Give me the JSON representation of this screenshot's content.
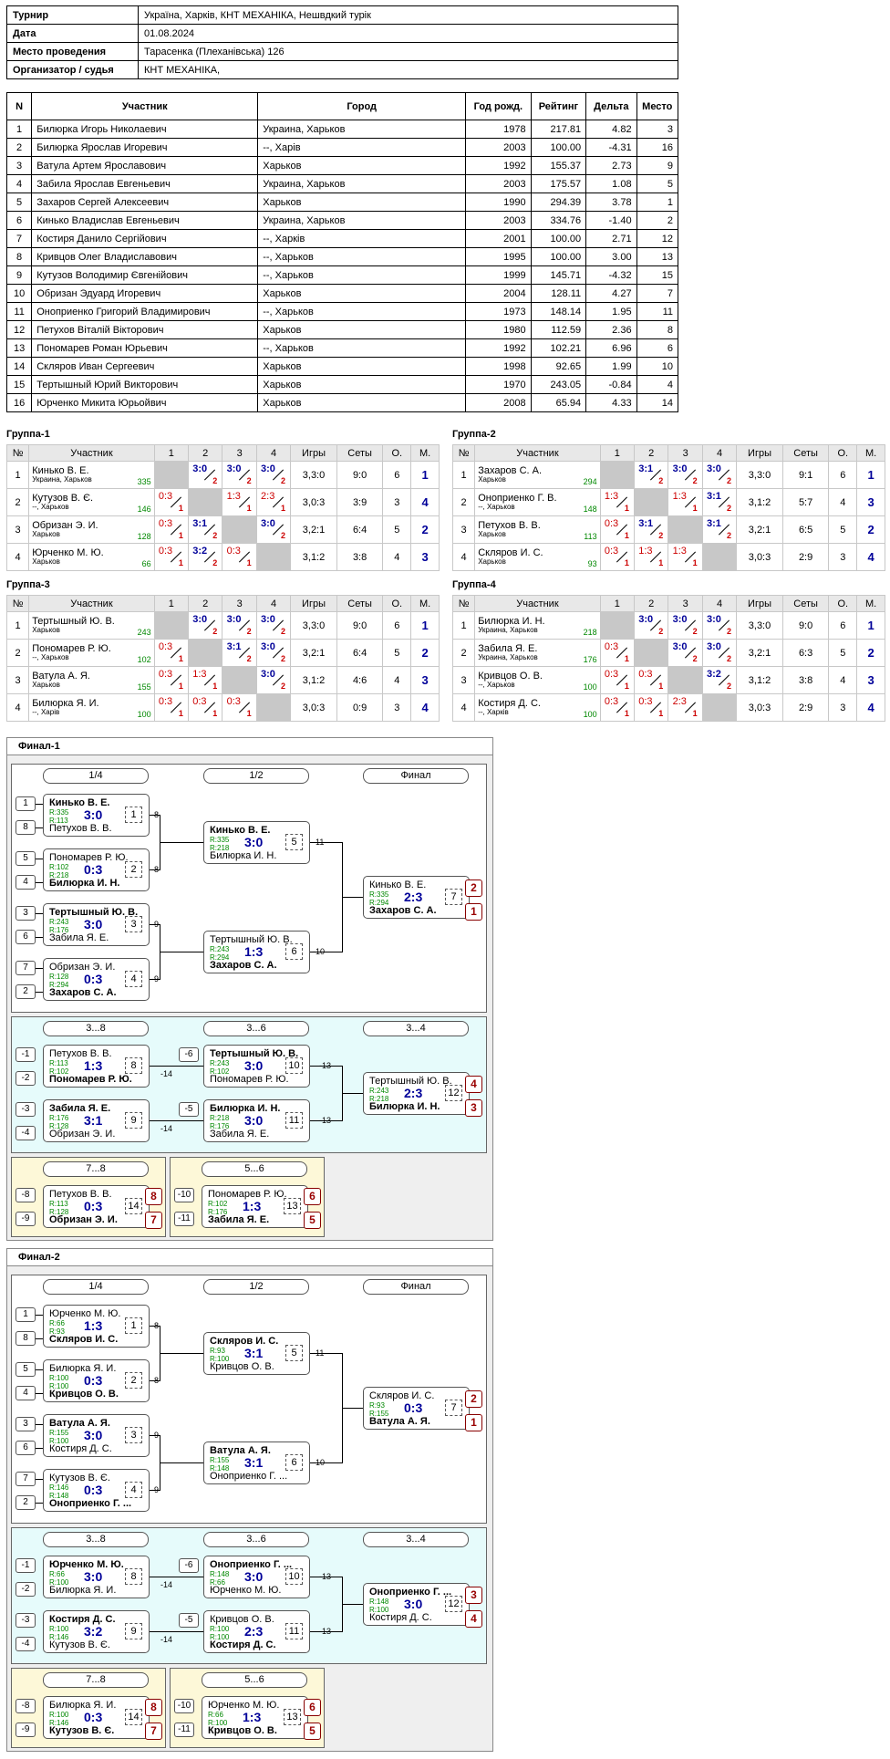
{
  "info": [
    {
      "k": "Турнир",
      "v": "Україна, Харків, КНТ МЕХАНІКА, Нешвдкий турік"
    },
    {
      "k": "Дата",
      "v": "01.08.2024"
    },
    {
      "k": "Место проведения",
      "v": "Тарасенка (Плеханівська) 126"
    },
    {
      "k": "Организатор / судья",
      "v": "КНТ МЕХАНІКА,"
    }
  ],
  "players_header": [
    "N",
    "Участник",
    "Город",
    "Год рожд.",
    "Рейтинг",
    "Дельта",
    "Место"
  ],
  "players": [
    [
      "1",
      "Билюрка Игорь Николаевич",
      "Украина, Харьков",
      "1978",
      "217.81",
      "4.82",
      "3"
    ],
    [
      "2",
      "Билюрка Ярослав Игоревич",
      "--, Харів",
      "2003",
      "100.00",
      "-4.31",
      "16"
    ],
    [
      "3",
      "Ватула Артем Ярославович",
      "Харьков",
      "1992",
      "155.37",
      "2.73",
      "9"
    ],
    [
      "4",
      "Забила Ярослав Евгеньевич",
      "Украина, Харьков",
      "2003",
      "175.57",
      "1.08",
      "5"
    ],
    [
      "5",
      "Захаров Сергей Алексеевич",
      "Харьков",
      "1990",
      "294.39",
      "3.78",
      "1"
    ],
    [
      "6",
      "Кинько Владислав Евгеньевич",
      "Украина, Харьков",
      "2003",
      "334.76",
      "-1.40",
      "2"
    ],
    [
      "7",
      "Костиря Данило Сергійович",
      "--, Харків",
      "2001",
      "100.00",
      "2.71",
      "12"
    ],
    [
      "8",
      "Кривцов Олег Владиславович",
      "--, Харьков",
      "1995",
      "100.00",
      "3.00",
      "13"
    ],
    [
      "9",
      "Кутузов Володимир Євгенійович",
      "--, Харьков",
      "1999",
      "145.71",
      "-4.32",
      "15"
    ],
    [
      "10",
      "Обризан Эдуард Игоревич",
      "Харьков",
      "2004",
      "128.11",
      "4.27",
      "7"
    ],
    [
      "11",
      "Оноприенко Григорий Владимирович",
      "--, Харьков",
      "1973",
      "148.14",
      "1.95",
      "11"
    ],
    [
      "12",
      "Петухов Віталій Вікторович",
      "Харьков",
      "1980",
      "112.59",
      "2.36",
      "8"
    ],
    [
      "13",
      "Пономарев Роман Юрьевич",
      "--, Харьков",
      "1992",
      "102.21",
      "6.96",
      "6"
    ],
    [
      "14",
      "Скляров Иван Сергеевич",
      "Харьков",
      "1998",
      "92.65",
      "1.99",
      "10"
    ],
    [
      "15",
      "Тертышный Юрий Викторович",
      "Харьков",
      "1970",
      "243.05",
      "-0.84",
      "4"
    ],
    [
      "16",
      "Юрченко Микита Юрьойвич",
      "Харьков",
      "2008",
      "65.94",
      "4.33",
      "14"
    ]
  ],
  "group_header": [
    "№",
    "Участник",
    "1",
    "2",
    "3",
    "4",
    "Игры",
    "Сеты",
    "О.",
    "М."
  ],
  "groups": [
    {
      "title": "Группа-1",
      "rows": [
        {
          "n": "1",
          "name": "Кинько В. Е.",
          "city": "Украина, Харьков",
          "r": "335",
          "res": [
            "",
            "3:0|2|w",
            "3:0|2|w",
            "3:0|2|w"
          ],
          "g": "3,3:0",
          "s": "9:0",
          "o": "6",
          "m": "1"
        },
        {
          "n": "2",
          "name": "Кутузов В. Є.",
          "city": "--, Харьков",
          "r": "146",
          "res": [
            "0:3|1|l",
            "",
            "1:3|1|l",
            "2:3|1|l"
          ],
          "g": "3,0:3",
          "s": "3:9",
          "o": "3",
          "m": "4"
        },
        {
          "n": "3",
          "name": "Обризан Э. И.",
          "city": "Харьков",
          "r": "128",
          "res": [
            "0:3|1|l",
            "3:1|2|w",
            "",
            "3:0|2|w"
          ],
          "g": "3,2:1",
          "s": "6:4",
          "o": "5",
          "m": "2"
        },
        {
          "n": "4",
          "name": "Юрченко М. Ю.",
          "city": "Харьков",
          "r": "66",
          "res": [
            "0:3|1|l",
            "3:2|2|w",
            "0:3|1|l",
            ""
          ],
          "g": "3,1:2",
          "s": "3:8",
          "o": "4",
          "m": "3"
        }
      ]
    },
    {
      "title": "Группа-2",
      "rows": [
        {
          "n": "1",
          "name": "Захаров С. А.",
          "city": "Харьков",
          "r": "294",
          "res": [
            "",
            "3:1|2|w",
            "3:0|2|w",
            "3:0|2|w"
          ],
          "g": "3,3:0",
          "s": "9:1",
          "o": "6",
          "m": "1"
        },
        {
          "n": "2",
          "name": "Оноприенко Г. В.",
          "city": "--, Харьков",
          "r": "148",
          "res": [
            "1:3|1|l",
            "",
            "1:3|1|l",
            "3:1|2|w"
          ],
          "g": "3,1:2",
          "s": "5:7",
          "o": "4",
          "m": "3"
        },
        {
          "n": "3",
          "name": "Петухов В. В.",
          "city": "Харьков",
          "r": "113",
          "res": [
            "0:3|1|l",
            "3:1|2|w",
            "",
            "3:1|2|w"
          ],
          "g": "3,2:1",
          "s": "6:5",
          "o": "5",
          "m": "2"
        },
        {
          "n": "4",
          "name": "Скляров И. С.",
          "city": "Харьков",
          "r": "93",
          "res": [
            "0:3|1|l",
            "1:3|1|l",
            "1:3|1|l",
            ""
          ],
          "g": "3,0:3",
          "s": "2:9",
          "o": "3",
          "m": "4"
        }
      ]
    },
    {
      "title": "Группа-3",
      "rows": [
        {
          "n": "1",
          "name": "Тертышный Ю. В.",
          "city": "Харьков",
          "r": "243",
          "res": [
            "",
            "3:0|2|w",
            "3:0|2|w",
            "3:0|2|w"
          ],
          "g": "3,3:0",
          "s": "9:0",
          "o": "6",
          "m": "1"
        },
        {
          "n": "2",
          "name": "Пономарев Р. Ю.",
          "city": "--, Харьков",
          "r": "102",
          "res": [
            "0:3|1|l",
            "",
            "3:1|2|w",
            "3:0|2|w"
          ],
          "g": "3,2:1",
          "s": "6:4",
          "o": "5",
          "m": "2"
        },
        {
          "n": "3",
          "name": "Ватула А. Я.",
          "city": "Харьков",
          "r": "155",
          "res": [
            "0:3|1|l",
            "1:3|1|l",
            "",
            "3:0|2|w"
          ],
          "g": "3,1:2",
          "s": "4:6",
          "o": "4",
          "m": "3"
        },
        {
          "n": "4",
          "name": "Билюрка Я. И.",
          "city": "--, Харів",
          "r": "100",
          "res": [
            "0:3|1|l",
            "0:3|1|l",
            "0:3|1|l",
            ""
          ],
          "g": "3,0:3",
          "s": "0:9",
          "o": "3",
          "m": "4"
        }
      ]
    },
    {
      "title": "Группа-4",
      "rows": [
        {
          "n": "1",
          "name": "Билюрка И. Н.",
          "city": "Украина, Харьков",
          "r": "218",
          "res": [
            "",
            "3:0|2|w",
            "3:0|2|w",
            "3:0|2|w"
          ],
          "g": "3,3:0",
          "s": "9:0",
          "o": "6",
          "m": "1"
        },
        {
          "n": "2",
          "name": "Забила Я. Е.",
          "city": "Украина, Харьков",
          "r": "176",
          "res": [
            "0:3|1|l",
            "",
            "3:0|2|w",
            "3:0|2|w"
          ],
          "g": "3,2:1",
          "s": "6:3",
          "o": "5",
          "m": "2"
        },
        {
          "n": "3",
          "name": "Кривцов О. В.",
          "city": "--, Харьков",
          "r": "100",
          "res": [
            "0:3|1|l",
            "0:3|1|l",
            "",
            "3:2|2|w"
          ],
          "g": "3,1:2",
          "s": "3:8",
          "o": "4",
          "m": "3"
        },
        {
          "n": "4",
          "name": "Костиря Д. С.",
          "city": "--, Харків",
          "r": "100",
          "res": [
            "0:3|1|l",
            "0:3|1|l",
            "2:3|1|l",
            ""
          ],
          "g": "3,0:3",
          "s": "2:9",
          "o": "3",
          "m": "4"
        }
      ]
    }
  ],
  "finals": [
    {
      "title": "Финал-1",
      "rounds1": [
        "1/4",
        "1/2",
        "Финал"
      ],
      "rounds2": [
        "3...8",
        "3...6",
        "3...4"
      ],
      "r78": "7...8",
      "r56": "5...6",
      "m": [
        {
          "id": "q1",
          "a": "Кинько В. Е.",
          "b": "Петухов В. В.",
          "ra": "R:335",
          "rb": "R:113",
          "sc": "3:0",
          "num": "1",
          "wa": true
        },
        {
          "id": "q2",
          "a": "Пономарев Р. Ю.",
          "b": "Билюрка И. Н.",
          "ra": "R:102",
          "rb": "R:218",
          "sc": "0:3",
          "num": "2",
          "wa": false
        },
        {
          "id": "q3",
          "a": "Тертышный Ю. В.",
          "b": "Забила Я. Е.",
          "ra": "R:243",
          "rb": "R:176",
          "sc": "3:0",
          "num": "3",
          "wa": true
        },
        {
          "id": "q4",
          "a": "Обризан Э. И.",
          "b": "Захаров С. А.",
          "ra": "R:128",
          "rb": "R:294",
          "sc": "0:3",
          "num": "4",
          "wa": false
        },
        {
          "id": "s1",
          "a": "Кинько В. Е.",
          "b": "Билюрка И. Н.",
          "ra": "R:335",
          "rb": "R:218",
          "sc": "3:0",
          "num": "5",
          "wa": true
        },
        {
          "id": "s2",
          "a": "Тертышный Ю. В.",
          "b": "Захаров С. А.",
          "ra": "R:243",
          "rb": "R:294",
          "sc": "1:3",
          "num": "6",
          "wa": false
        },
        {
          "id": "f",
          "a": "Кинько В. Е.",
          "b": "Захаров С. А.",
          "ra": "R:335",
          "rb": "R:294",
          "sc": "2:3",
          "num": "7",
          "wa": false
        },
        {
          "id": "c1",
          "a": "Петухов В. В.",
          "b": "Пономарев Р. Ю.",
          "ra": "R:113",
          "rb": "R:102",
          "sc": "1:3",
          "num": "8",
          "wa": false
        },
        {
          "id": "c2",
          "a": "Забила Я. Е.",
          "b": "Обризан Э. И.",
          "ra": "R:176",
          "rb": "R:128",
          "sc": "3:1",
          "num": "9",
          "wa": true
        },
        {
          "id": "c3",
          "a": "Тертышный Ю. В.",
          "b": "Пономарев Р. Ю.",
          "ra": "R:243",
          "rb": "R:102",
          "sc": "3:0",
          "num": "10",
          "wa": true
        },
        {
          "id": "c4",
          "a": "Билюрка И. Н.",
          "b": "Забила Я. Е.",
          "ra": "R:218",
          "rb": "R:176",
          "sc": "3:0",
          "num": "11",
          "wa": true
        },
        {
          "id": "c5",
          "a": "Тертышный Ю. В.",
          "b": "Билюрка И. Н.",
          "ra": "R:243",
          "rb": "R:218",
          "sc": "2:3",
          "num": "12",
          "wa": false
        },
        {
          "id": "c6",
          "a": "Петухов В. В.",
          "b": "Обризан Э. И.",
          "ra": "R:113",
          "rb": "R:128",
          "sc": "0:3",
          "num": "14",
          "wa": false
        },
        {
          "id": "c7",
          "a": "Пономарев Р. Ю.",
          "b": "Забила Я. Е.",
          "ra": "R:102",
          "rb": "R:176",
          "sc": "1:3",
          "num": "13",
          "wa": false
        }
      ],
      "seeds": [
        "1",
        "8",
        "5",
        "4",
        "3",
        "6",
        "7",
        "2"
      ],
      "csd": [
        "-1",
        "-2",
        "-3",
        "-4",
        "-6",
        "-5",
        "-8",
        "-9",
        "-10",
        "-11"
      ],
      "links": [
        "-8",
        "-8",
        "-9",
        "-9",
        "-11",
        "-10",
        "-14",
        "-14",
        "-13",
        "-13"
      ],
      "places": [
        "2",
        "1",
        "4",
        "3",
        "8",
        "7",
        "6",
        "5"
      ]
    },
    {
      "title": "Финал-2",
      "rounds1": [
        "1/4",
        "1/2",
        "Финал"
      ],
      "rounds2": [
        "3...8",
        "3...6",
        "3...4"
      ],
      "r78": "7...8",
      "r56": "5...6",
      "m": [
        {
          "id": "q1",
          "a": "Юрченко М. Ю.",
          "b": "Скляров И. С.",
          "ra": "R:66",
          "rb": "R:93",
          "sc": "1:3",
          "num": "1",
          "wa": false
        },
        {
          "id": "q2",
          "a": "Билюрка Я. И.",
          "b": "Кривцов О. В.",
          "ra": "R:100",
          "rb": "R:100",
          "sc": "0:3",
          "num": "2",
          "wa": false
        },
        {
          "id": "q3",
          "a": "Ватула А. Я.",
          "b": "Костиря Д. С.",
          "ra": "R:155",
          "rb": "R:100",
          "sc": "3:0",
          "num": "3",
          "wa": true
        },
        {
          "id": "q4",
          "a": "Кутузов В. Є.",
          "b": "Оноприенко Г. ...",
          "ra": "R:146",
          "rb": "R:148",
          "sc": "0:3",
          "num": "4",
          "wa": false
        },
        {
          "id": "s1",
          "a": "Скляров И. С.",
          "b": "Кривцов О. В.",
          "ra": "R:93",
          "rb": "R:100",
          "sc": "3:1",
          "num": "5",
          "wa": true
        },
        {
          "id": "s2",
          "a": "Ватула А. Я.",
          "b": "Оноприенко Г. ...",
          "ra": "R:155",
          "rb": "R:148",
          "sc": "3:1",
          "num": "6",
          "wa": true
        },
        {
          "id": "f",
          "a": "Скляров И. С.",
          "b": "Ватула А. Я.",
          "ra": "R:93",
          "rb": "R:155",
          "sc": "0:3",
          "num": "7",
          "wa": false
        },
        {
          "id": "c1",
          "a": "Юрченко М. Ю.",
          "b": "Билюрка Я. И.",
          "ra": "R:66",
          "rb": "R:100",
          "sc": "3:0",
          "num": "8",
          "wa": true
        },
        {
          "id": "c2",
          "a": "Костиря Д. С.",
          "b": "Кутузов В. Є.",
          "ra": "R:100",
          "rb": "R:146",
          "sc": "3:2",
          "num": "9",
          "wa": true
        },
        {
          "id": "c3",
          "a": "Оноприенко Г. ...",
          "b": "Юрченко М. Ю.",
          "ra": "R:148",
          "rb": "R:66",
          "sc": "3:0",
          "num": "10",
          "wa": true
        },
        {
          "id": "c4",
          "a": "Кривцов О. В.",
          "b": "Костиря Д. С.",
          "ra": "R:100",
          "rb": "R:100",
          "sc": "2:3",
          "num": "11",
          "wa": false
        },
        {
          "id": "c5",
          "a": "Оноприенко Г. ...",
          "b": "Костиря Д. С.",
          "ra": "R:148",
          "rb": "R:100",
          "sc": "3:0",
          "num": "12",
          "wa": true
        },
        {
          "id": "c6",
          "a": "Билюрка Я. И.",
          "b": "Кутузов В. Є.",
          "ra": "R:100",
          "rb": "R:146",
          "sc": "0:3",
          "num": "14",
          "wa": false
        },
        {
          "id": "c7",
          "a": "Юрченко М. Ю.",
          "b": "Кривцов О. В.",
          "ra": "R:66",
          "rb": "R:100",
          "sc": "1:3",
          "num": "13",
          "wa": false
        }
      ],
      "seeds": [
        "1",
        "8",
        "5",
        "4",
        "3",
        "6",
        "7",
        "2"
      ],
      "csd": [
        "-1",
        "-2",
        "-3",
        "-4",
        "-6",
        "-5",
        "-8",
        "-9",
        "-10",
        "-11"
      ],
      "links": [
        "-8",
        "-8",
        "-9",
        "-9",
        "-11",
        "-10",
        "-14",
        "-14",
        "-13",
        "-13"
      ],
      "places": [
        "2",
        "1",
        "3",
        "4",
        "8",
        "7",
        "6",
        "5"
      ]
    }
  ]
}
